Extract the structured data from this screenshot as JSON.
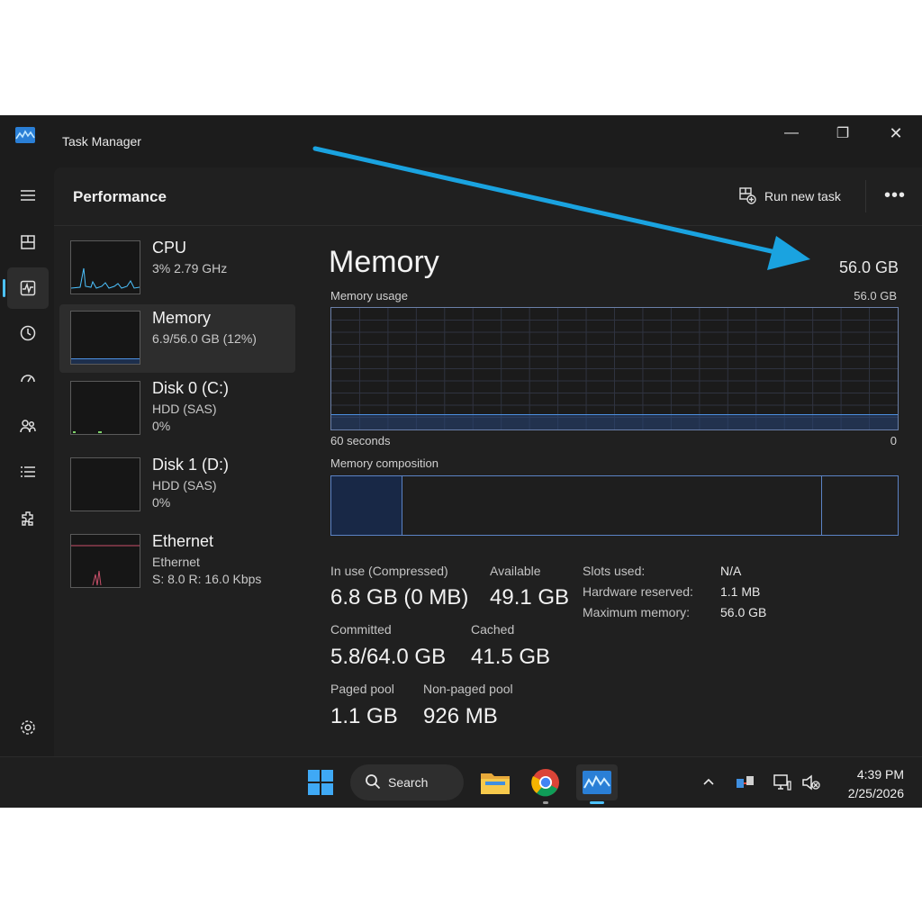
{
  "window": {
    "title": "Task Manager",
    "minimize": "—",
    "maximize": "❐",
    "close": "✕"
  },
  "header": {
    "title": "Performance",
    "run_new_task": "Run new task",
    "more": "•••"
  },
  "nav": [
    {
      "name": "menu-icon",
      "active": false
    },
    {
      "name": "processes-icon",
      "active": false
    },
    {
      "name": "performance-icon",
      "active": true
    },
    {
      "name": "app-history-icon",
      "active": false
    },
    {
      "name": "startup-apps-icon",
      "active": false
    },
    {
      "name": "users-icon",
      "active": false
    },
    {
      "name": "details-icon",
      "active": false
    },
    {
      "name": "services-icon",
      "active": false
    },
    {
      "name": "settings-icon",
      "active": false
    }
  ],
  "devices": [
    {
      "name": "CPU",
      "line1": "3% 2.79 GHz",
      "line2": ""
    },
    {
      "name": "Memory",
      "line1": "6.9/56.0 GB (12%)",
      "line2": ""
    },
    {
      "name": "Disk 0 (C:)",
      "line1": "HDD (SAS)",
      "line2": "0%"
    },
    {
      "name": "Disk 1 (D:)",
      "line1": "HDD (SAS)",
      "line2": "0%"
    },
    {
      "name": "Ethernet",
      "line1": "Ethernet",
      "line2": "S: 8.0 R: 16.0 Kbps"
    }
  ],
  "detail": {
    "title": "Memory",
    "total": "56.0 GB",
    "usage_label": "Memory usage",
    "usage_max": "56.0 GB",
    "usage_fraction": 0.12,
    "time_left": "60 seconds",
    "time_right": "0",
    "composition_label": "Memory composition",
    "stats": {
      "in_use_label": "In use (Compressed)",
      "in_use_value": "6.8 GB (0 MB)",
      "available_label": "Available",
      "available_value": "49.1 GB",
      "committed_label": "Committed",
      "committed_value": "5.8/64.0 GB",
      "cached_label": "Cached",
      "cached_value": "41.5 GB",
      "paged_label": "Paged pool",
      "paged_value": "1.1 GB",
      "nonpaged_label": "Non-paged pool",
      "nonpaged_value": "926 MB"
    },
    "kv": [
      {
        "label": "Slots used:",
        "value": "N/A"
      },
      {
        "label": "Hardware reserved:",
        "value": "1.1 MB"
      },
      {
        "label": "Maximum memory:",
        "value": "56.0 GB"
      }
    ]
  },
  "taskbar": {
    "search": "Search",
    "time": "4:39 PM",
    "date": "2/25/2026"
  },
  "colors": {
    "accent": "#4cc2ff",
    "memory_line": "#4c8fe0",
    "annotation_arrow": "#1aa3e0"
  }
}
